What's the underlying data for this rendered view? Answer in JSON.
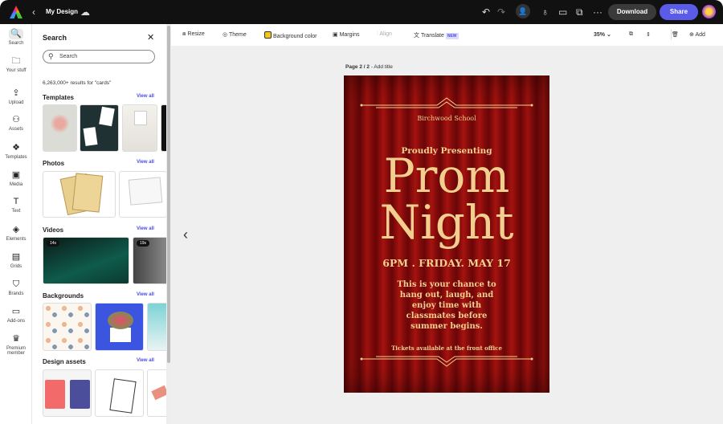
{
  "header": {
    "title": "My Design",
    "download": "Download",
    "share": "Share",
    "icons": [
      "adobe-express-logo",
      "back-chevron",
      "cloud-icon",
      "undo-icon",
      "redo-icon",
      "invite-icon",
      "lightbulb-icon",
      "comment-icon",
      "duplicate-icon",
      "more-icon"
    ]
  },
  "rail": [
    {
      "label": "Search",
      "icon": "search-icon",
      "g": "🔍"
    },
    {
      "label": "Your stuff",
      "icon": "folder-icon",
      "g": "🗀"
    },
    {
      "label": "Upload",
      "icon": "upload-icon",
      "g": "⇪"
    },
    {
      "label": "Assets",
      "icon": "assets-icon",
      "g": "⚇"
    },
    {
      "label": "Templates",
      "icon": "templates-icon",
      "g": "❖"
    },
    {
      "label": "Media",
      "icon": "media-icon",
      "g": "▣"
    },
    {
      "label": "Text",
      "icon": "text-icon",
      "g": "T"
    },
    {
      "label": "Elements",
      "icon": "elements-icon",
      "g": "◈"
    },
    {
      "label": "Grids",
      "icon": "grids-icon",
      "g": "▤"
    },
    {
      "label": "Brands",
      "icon": "brands-icon",
      "g": "⛉"
    },
    {
      "label": "Add-ons",
      "icon": "addons-icon",
      "g": "▭"
    },
    {
      "label": "Premium member",
      "icon": "crown-icon",
      "g": "♛"
    }
  ],
  "panel": {
    "title": "Search",
    "search_placeholder": "Search",
    "results": "6,263,000+ results for \"cards\"",
    "view_all": "View all",
    "sections": [
      "Templates",
      "Photos",
      "Videos",
      "Backgrounds",
      "Design assets"
    ],
    "videos": [
      "14s",
      "19s"
    ]
  },
  "toolbar": {
    "resize": "Resize",
    "theme": "Theme",
    "bg": "Background color",
    "margins": "Margins",
    "align": "Align",
    "translate": "Translate",
    "new": "NEW",
    "zoom": "35%",
    "add": "Add",
    "bg_swatch": "#f5c518"
  },
  "canvas": {
    "page_num": "Page 2 / 2",
    "add_title": "- Add title"
  },
  "poster": {
    "school": "Birchwood School",
    "presenting": "Proudly Presenting",
    "line1": "Prom",
    "line2": "Night",
    "when": "6PM . FRIDAY. MAY 17",
    "body": "This is your chance to hang out, laugh, and enjoy time with classmates before summer begins.",
    "tickets": "Tickets available at the front office"
  },
  "colors": {
    "accent": "#5b5bea",
    "poster_text": "#f3cf8f",
    "poster_bg": "#8b0d0d"
  }
}
